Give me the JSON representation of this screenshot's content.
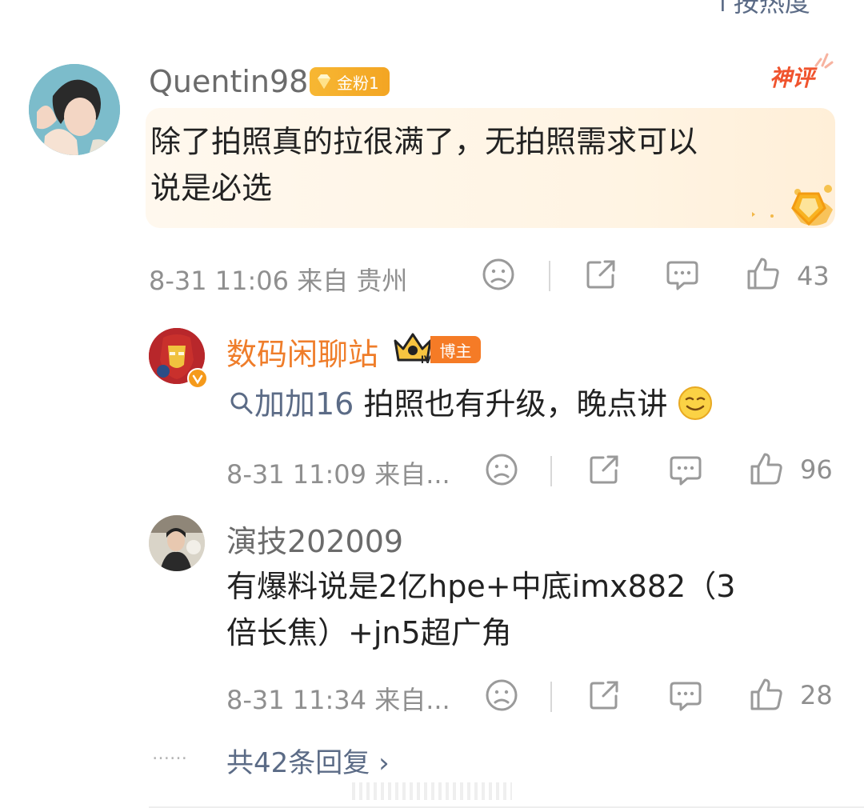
{
  "top_sort_label": "↑按热度",
  "comment": {
    "username": "Quentin98",
    "fan_badge": "金粉1",
    "hot_tag": "神评",
    "text": "除了拍照真的拉很满了，无拍照需求可以说是必选",
    "text_line1": "除了拍照真的拉很满了，无拍照需求可以",
    "text_line2": "说是必选",
    "meta": "8-31 11:06 来自 贵州",
    "likes": "43"
  },
  "replies": [
    {
      "username": "数码闲聊站",
      "badge": "博主",
      "mention": "加加16",
      "text": " 拍照也有升级，晚点讲",
      "meta": "8-31 11:09 来自...",
      "likes": "96"
    },
    {
      "username": "演技202009",
      "text_line1": "有爆料说是2亿hpe+中底imx882（3",
      "text_line2": "倍长焦）+jn5超广角",
      "meta": "8-31 11:34 来自...",
      "likes": "28"
    }
  ],
  "more_replies": "共42条回复 ›",
  "more_dots": "……",
  "colors": {
    "accent_orange": "#ef7d2a",
    "link_blue": "#5b6b86",
    "meta_grey": "#8f8f8f"
  }
}
